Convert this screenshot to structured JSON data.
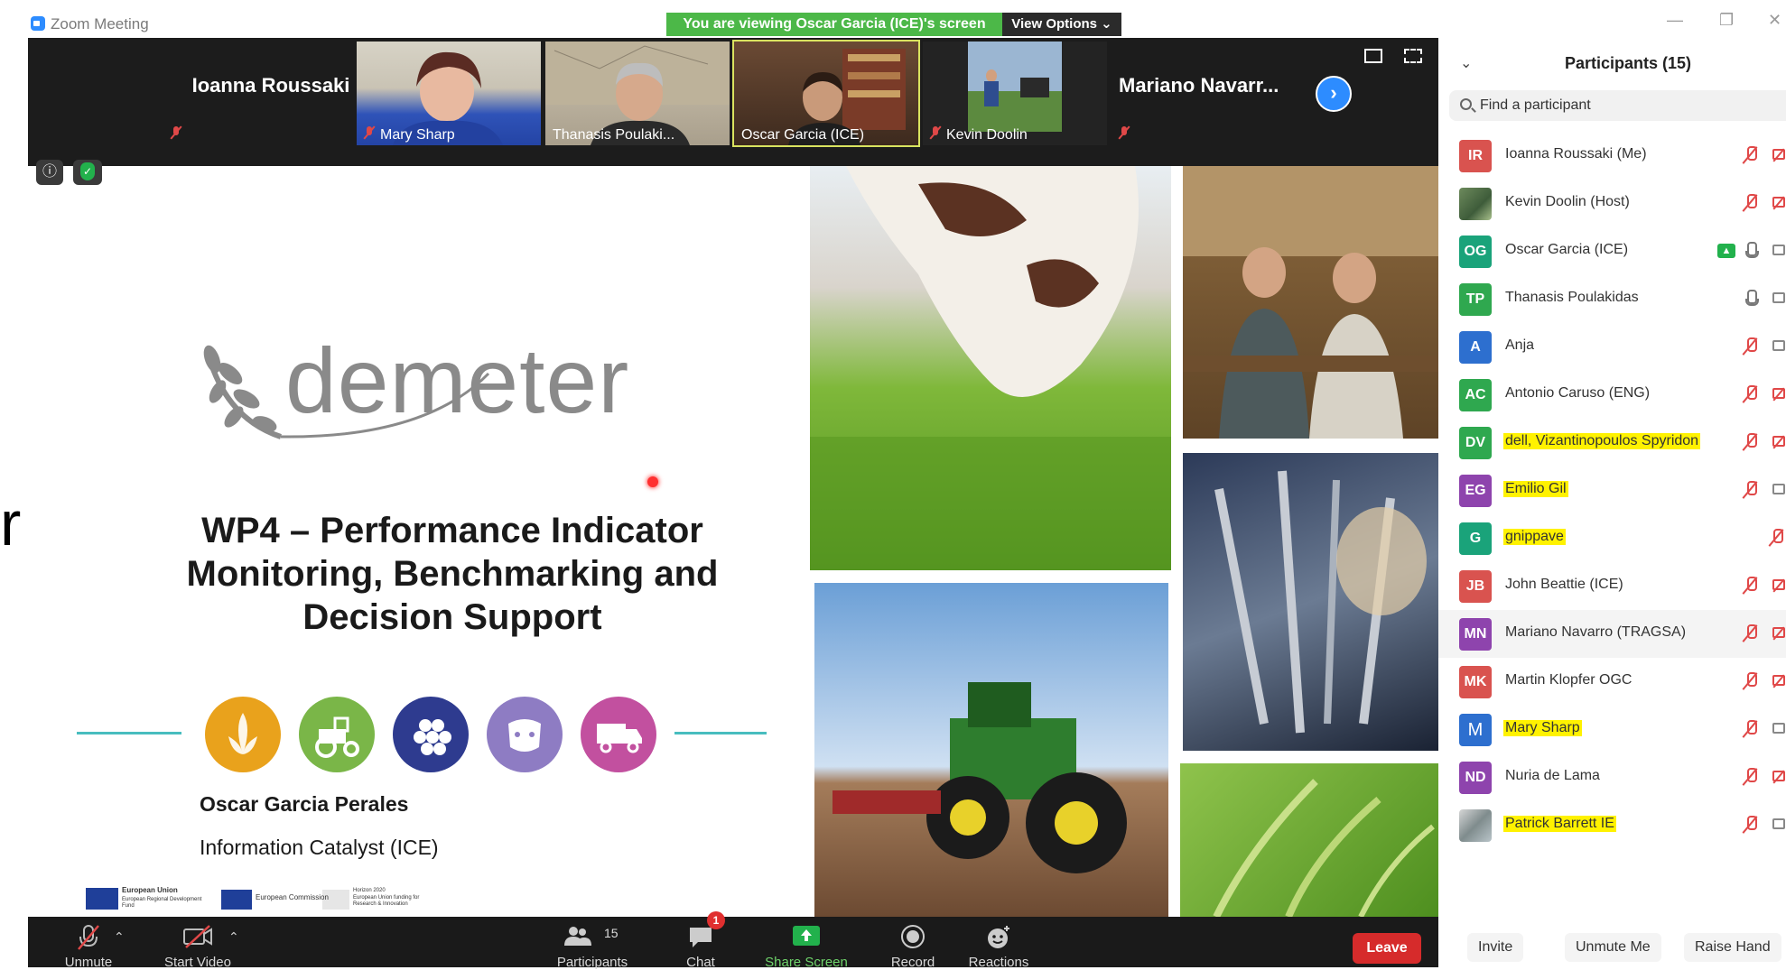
{
  "window": {
    "title": "Zoom Meeting",
    "viewing_banner": "You are viewing Oscar Garcia (ICE)'s screen",
    "view_options": "View Options ⌄"
  },
  "video_strip": {
    "tiles": [
      {
        "name": "Ioanna Roussaki"
      },
      {
        "name": "Mary Sharp"
      },
      {
        "name": "Thanasis Poulaki..."
      },
      {
        "name": "Oscar Garcia (ICE)"
      },
      {
        "name": "Kevin Doolin"
      },
      {
        "name": "Mariano  Navarr..."
      }
    ]
  },
  "slide": {
    "logo_text": "demeter",
    "title": "WP4 – Performance Indicator Monitoring, Benchmarking and Decision Support",
    "presenter": "Oscar Garcia Perales",
    "organization": "Information Catalyst (ICE)",
    "side_fragment": "r",
    "eu_logo_texts": [
      "European Union",
      "European Regional Development Fund",
      "European Commission",
      "Horizon 2020",
      "European Union funding for Research & Innovation"
    ],
    "icon_colors": [
      "#e9a21c",
      "#7ab648",
      "#2e3b8f",
      "#8e7cc3",
      "#c2509f"
    ],
    "icon_names": [
      "wheat-icon",
      "tractor-icon",
      "grapes-icon",
      "cow-icon",
      "truck-icon"
    ]
  },
  "toolbar": {
    "unmute": "Unmute",
    "start_video": "Start Video",
    "participants_count": "15",
    "participants": "Participants",
    "chat": "Chat",
    "chat_badge": "1",
    "share_screen": "Share Screen",
    "record": "Record",
    "reactions": "Reactions",
    "leave": "Leave"
  },
  "panel": {
    "title": "Participants (15)",
    "search_placeholder": "Find a participant",
    "participants": [
      {
        "initials": "IR",
        "name": "Ioanna Roussaki (Me)",
        "color": "#d9534f",
        "highlight": false
      },
      {
        "initials": "",
        "name": "Kevin Doolin (Host)",
        "color": "",
        "highlight": false
      },
      {
        "initials": "OG",
        "name": "Oscar Garcia (ICE)",
        "color": "#1aa37a",
        "highlight": false
      },
      {
        "initials": "TP",
        "name": "Thanasis Poulakidas",
        "color": "#2fa84f",
        "highlight": false
      },
      {
        "initials": "A",
        "name": "Anja",
        "color": "#2d6fcf",
        "highlight": false
      },
      {
        "initials": "AC",
        "name": "Antonio Caruso (ENG)",
        "color": "#2fa84f",
        "highlight": false
      },
      {
        "initials": "DV",
        "name": "dell, Vizantinopoulos  Spyridon",
        "color": "#2fa84f",
        "highlight": true
      },
      {
        "initials": "EG",
        "name": "Emilio Gil",
        "color": "#8e44ad",
        "highlight": true
      },
      {
        "initials": "G",
        "name": "gnippave",
        "color": "#1aa37a",
        "highlight": true
      },
      {
        "initials": "JB",
        "name": "John Beattie (ICE)",
        "color": "#d9534f",
        "highlight": false
      },
      {
        "initials": "MN",
        "name": "Mariano Navarro (TRAGSA)",
        "color": "#8e44ad",
        "highlight": false
      },
      {
        "initials": "MK",
        "name": "Martin Klopfer OGC",
        "color": "#d9534f",
        "highlight": false
      },
      {
        "initials": "M",
        "name": "Mary Sharp",
        "color": "#2d6fcf",
        "highlight": true
      },
      {
        "initials": "ND",
        "name": "Nuria de Lama",
        "color": "#8e44ad",
        "highlight": false
      },
      {
        "initials": "",
        "name": "Patrick Barrett IE",
        "color": "",
        "highlight": true
      }
    ],
    "footer": {
      "invite": "Invite",
      "unmute_me": "Unmute Me",
      "raise_hand": "Raise Hand"
    }
  }
}
